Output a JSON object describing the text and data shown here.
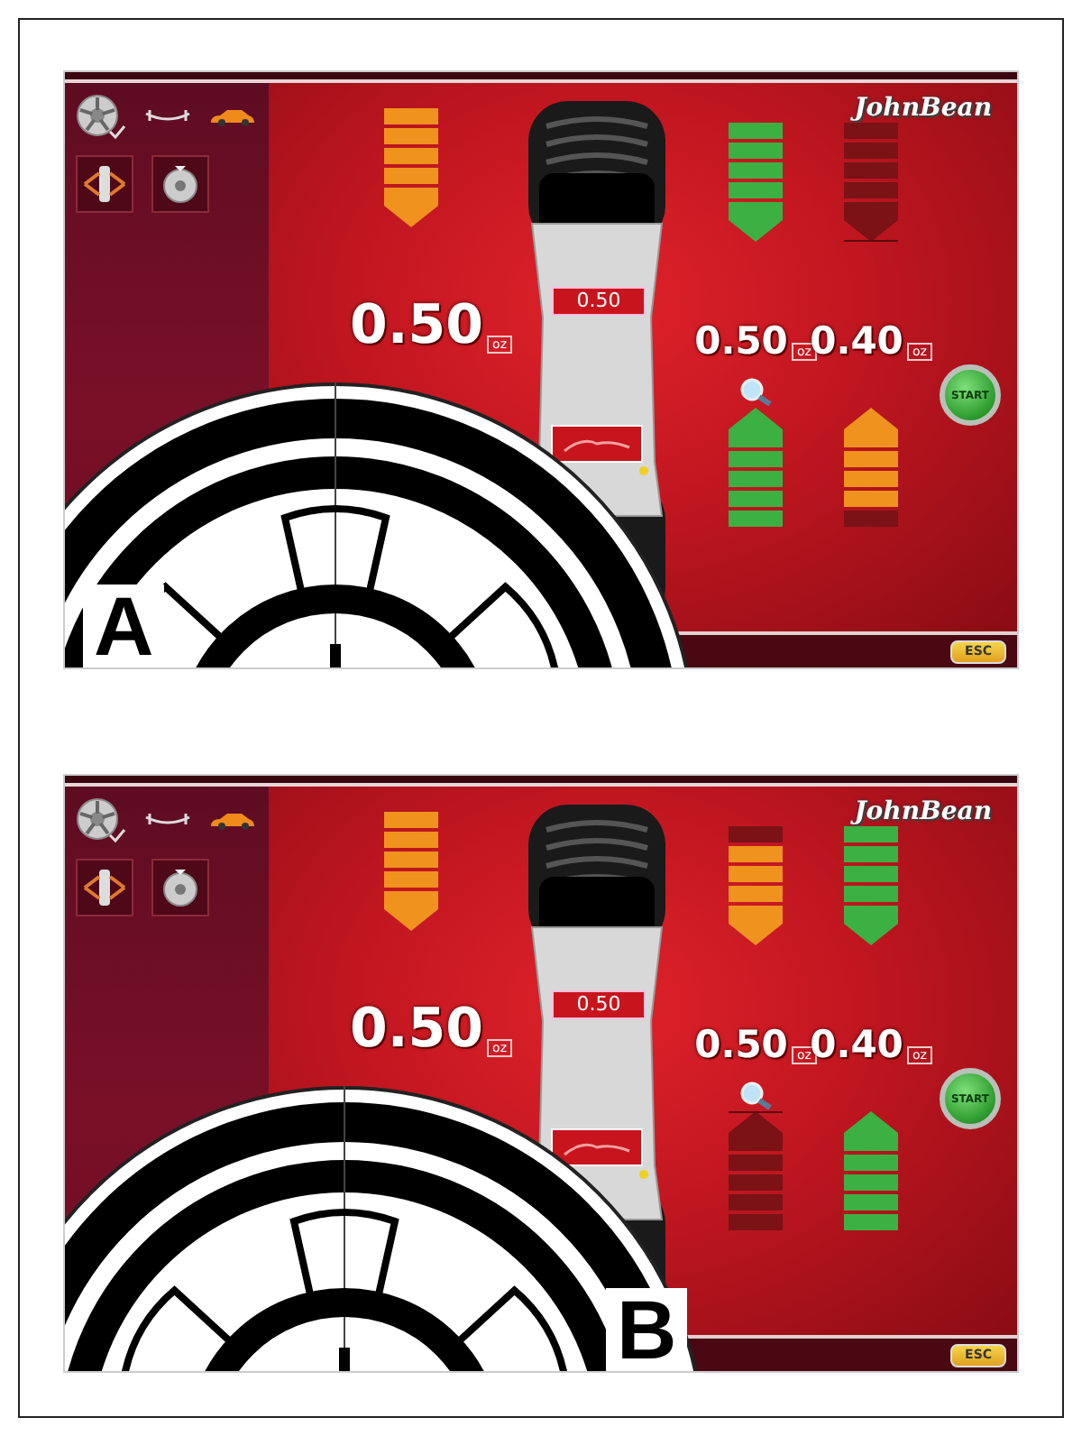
{
  "panels": [
    {
      "label": "A",
      "brand": "JohnBean",
      "left_meter": {
        "kind": "down",
        "color": "#f0921e",
        "level": 1
      },
      "main_value": "0.50",
      "main_unit": "oz",
      "center_value": "0.50",
      "right_columns": [
        {
          "down_meter": {
            "kind": "down",
            "color": "#3cb043",
            "level": 1
          },
          "value": "0.50",
          "unit": "oz",
          "up_meter": {
            "kind": "up",
            "color": "#3cb043",
            "level": 1
          }
        },
        {
          "down_meter": {
            "kind": "down",
            "level": 0
          },
          "value": "0.40",
          "unit": "oz",
          "up_meter": {
            "kind": "up",
            "color": "#f0921e",
            "level": 0.8
          }
        }
      ],
      "start_button": "START",
      "esc_button": "ESC"
    },
    {
      "label": "B",
      "brand": "JohnBean",
      "left_meter": {
        "kind": "down",
        "color": "#f0921e",
        "level": 1
      },
      "main_value": "0.50",
      "main_unit": "oz",
      "center_value": "0.50",
      "right_columns": [
        {
          "down_meter": {
            "kind": "down",
            "color": "#f0921e",
            "level": 0.8
          },
          "value": "0.50",
          "unit": "oz",
          "up_meter": {
            "kind": "up",
            "level": 0
          }
        },
        {
          "down_meter": {
            "kind": "down",
            "color": "#3cb043",
            "level": 1
          },
          "value": "0.40",
          "unit": "oz",
          "up_meter": {
            "kind": "up",
            "color": "#3cb043",
            "level": 1
          }
        }
      ],
      "start_button": "START",
      "esc_button": "ESC"
    }
  ]
}
